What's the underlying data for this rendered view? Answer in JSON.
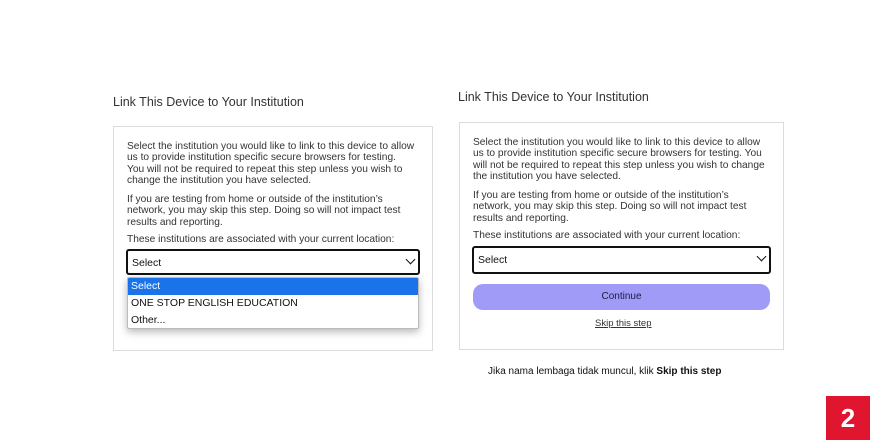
{
  "left_panel": {
    "title": "Link This Device to Your Institution",
    "para1": "Select the institution you would like to link to this device to allow us to provide institution specific secure browsers for testing. You will not be required to repeat this step unless you wish to change the institution you have selected.",
    "para2": "If you are testing from home or outside of the institution’s network, you may skip this step. Doing so will not impact test results and reporting.",
    "para3": "These institutions are associated with your current location:",
    "select_value": "Select",
    "dropdown_options": [
      "Select",
      "ONE STOP ENGLISH EDUCATION",
      "Other..."
    ]
  },
  "right_panel": {
    "title": "Link This Device to Your Institution",
    "para1": "Select the institution you would like to link to this device to allow us to provide institution specific secure browsers for testing. You will not be required to repeat this step unless you wish to change the institution you have selected.",
    "para2": "If you are testing from home or outside of the institution’s network, you may skip this step. Doing so will not impact test results and reporting.",
    "para3": "These institutions are associated with your current location:",
    "select_value": "Select",
    "continue_label": "Continue",
    "skip_label": "Skip this step"
  },
  "caption": {
    "prefix": "Jika nama lembaga tidak muncul, klik ",
    "bold": "Skip this step"
  },
  "page_number": "2",
  "colors": {
    "continue_button": "#a09bf7",
    "selected_option": "#1a73e8",
    "badge": "#e0152f"
  }
}
